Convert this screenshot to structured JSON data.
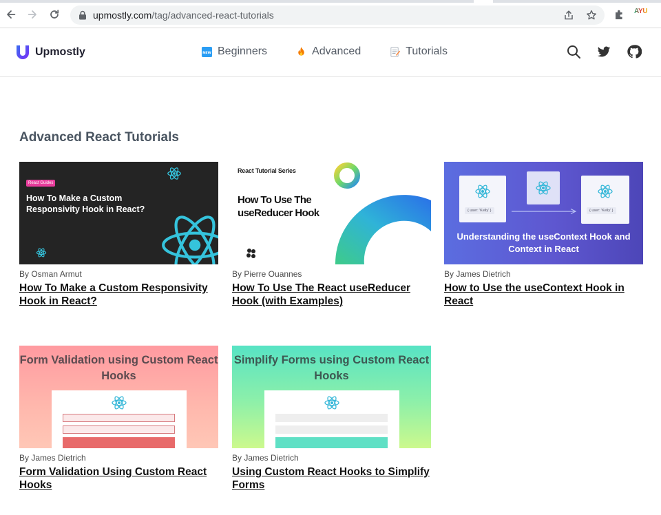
{
  "browser": {
    "url_domain": "upmostly.com",
    "url_path": "/tag/advanced-react-tutorials",
    "extension_label": "AYU",
    "icons": [
      "back-icon",
      "forward-icon",
      "reload-icon",
      "lock-icon",
      "share-icon",
      "bookmark-star-icon",
      "puzzle-extensions-icon"
    ]
  },
  "site": {
    "brand": "Upmostly",
    "nav": [
      {
        "label": "Beginners",
        "icon": "new-badge-icon"
      },
      {
        "label": "Advanced",
        "icon": "fire-icon"
      },
      {
        "label": "Tutorials",
        "icon": "memo-icon"
      }
    ],
    "header_icons": [
      "search-icon",
      "twitter-icon",
      "github-icon"
    ],
    "colors": {
      "brand_gradient_start": "#3a6df0",
      "brand_gradient_end": "#7b2ff7"
    }
  },
  "page": {
    "title": "Advanced React Tutorials",
    "articles": [
      {
        "byline": "By Osman Armut",
        "title": "How To Make a Custom Responsivity Hook in React?",
        "thumb": {
          "tag": "React Guides",
          "headline": "How To Make a Custom Responsivity Hook in React?"
        }
      },
      {
        "byline": "By Pierre Ouannes",
        "title": "How To Use The React useReducer Hook (with Examples)",
        "thumb": {
          "series": "React Tutorial Series",
          "headline": "How To Use The useReducer Hook"
        }
      },
      {
        "byline": "By James Dietrich",
        "title": "How to Use the useContext Hook in React",
        "thumb": {
          "pill_1": "{ user: 'Kelly' }",
          "pill_2": "{ user: 'Kelly' }",
          "headline": "Understanding the useContext Hook and Context in React"
        }
      },
      {
        "byline": "By James Dietrich",
        "title": "Form Validation Using Custom React Hooks",
        "thumb": {
          "headline": "Form Validation using Custom React Hooks"
        }
      },
      {
        "byline": "By James Dietrich",
        "title": "Using Custom React Hooks to Simplify Forms",
        "thumb": {
          "headline": "Simplify Forms using Custom React Hooks"
        }
      }
    ]
  }
}
